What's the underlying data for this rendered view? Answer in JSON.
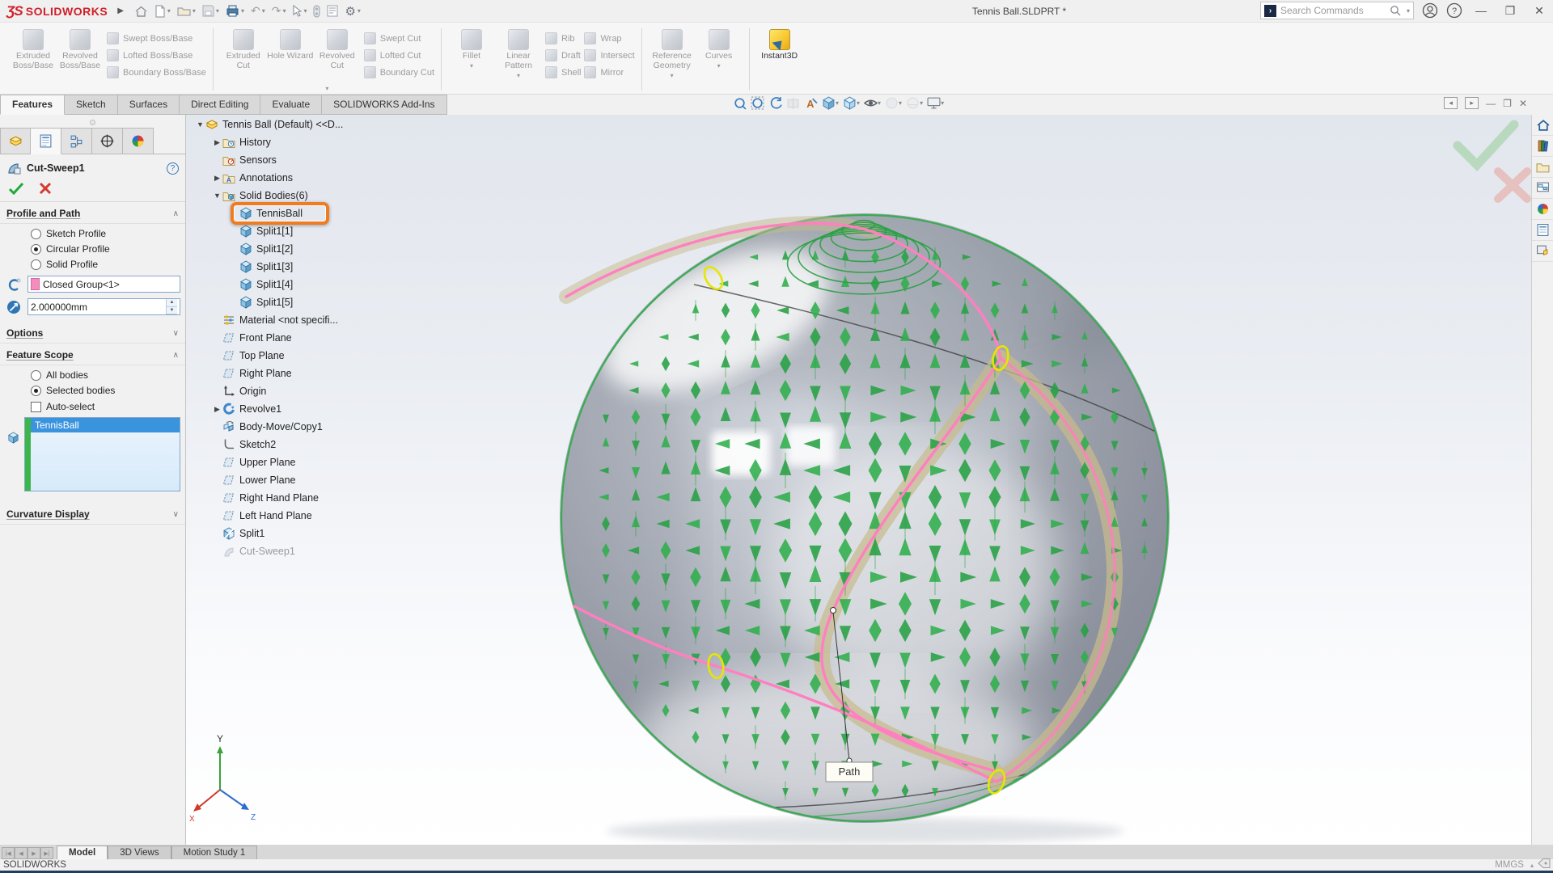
{
  "titlebar": {
    "logo_ds": "ƷS",
    "logo_text": "SOLIDWORKS",
    "doc_title": "Tennis Ball.SLDPRT *",
    "search_placeholder": "Search Commands"
  },
  "tabs": {
    "items": [
      "Features",
      "Sketch",
      "Surfaces",
      "Direct Editing",
      "Evaluate",
      "SOLIDWORKS Add-Ins"
    ],
    "active": "Features"
  },
  "ribbon": {
    "groups": [
      {
        "big": [
          "Extruded Boss/Base",
          "Revolved Boss/Base"
        ],
        "stack": [
          "Swept Boss/Base",
          "Lofted Boss/Base",
          "Boundary Boss/Base"
        ]
      },
      {
        "big": [
          "Extruded Cut",
          "Hole Wizard",
          "Revolved Cut"
        ],
        "stack": [
          "Swept Cut",
          "Lofted Cut",
          "Boundary Cut"
        ],
        "caret": true
      },
      {
        "big": [
          "Fillet",
          "Linear Pattern"
        ],
        "stack": [
          "Rib",
          "Draft",
          "Shell"
        ],
        "stack2": [
          "Wrap",
          "Intersect",
          "Mirror"
        ],
        "bigcarets": true
      },
      {
        "big": [
          "Reference Geometry",
          "Curves"
        ],
        "bigcarets": true
      },
      {
        "big": [
          "Instant3D"
        ],
        "enabled": true
      }
    ]
  },
  "property_manager": {
    "title": "Cut-Sweep1",
    "profile_and_path": {
      "header": "Profile and Path",
      "radios": [
        "Sketch Profile",
        "Circular Profile",
        "Solid Profile"
      ],
      "selected_radio": "Circular Profile",
      "path_value": "Closed Group<1>",
      "diameter_value": "2.000000mm"
    },
    "options_header": "Options",
    "feature_scope": {
      "header": "Feature Scope",
      "radios": [
        "All bodies",
        "Selected bodies"
      ],
      "selected_radio": "Selected bodies",
      "auto_select_label": "Auto-select",
      "auto_select_checked": false,
      "bodies": [
        "TennisBall"
      ]
    },
    "curvature_header": "Curvature Display"
  },
  "feature_tree": {
    "root": {
      "label": "Tennis Ball (Default) <<D...",
      "icon": "part",
      "arrow": "down",
      "level": 0
    },
    "items": [
      {
        "label": "History",
        "icon": "history",
        "arrow": "right",
        "level": 1
      },
      {
        "label": "Sensors",
        "icon": "sensors",
        "level": 1
      },
      {
        "label": "Annotations",
        "icon": "annotations",
        "arrow": "right",
        "level": 1
      },
      {
        "label": "Solid Bodies(6)",
        "icon": "bodies_folder",
        "arrow": "down",
        "level": 1
      },
      {
        "label": "TennisBall",
        "icon": "body",
        "level": 2,
        "highlight": true
      },
      {
        "label": "Split1[1]",
        "icon": "body",
        "level": 2
      },
      {
        "label": "Split1[2]",
        "icon": "body",
        "level": 2
      },
      {
        "label": "Split1[3]",
        "icon": "body",
        "level": 2
      },
      {
        "label": "Split1[4]",
        "icon": "body",
        "level": 2
      },
      {
        "label": "Split1[5]",
        "icon": "body",
        "level": 2
      },
      {
        "label": "Material <not specifi...",
        "icon": "material",
        "level": 1
      },
      {
        "label": "Front Plane",
        "icon": "plane",
        "level": 1
      },
      {
        "label": "Top Plane",
        "icon": "plane",
        "level": 1
      },
      {
        "label": "Right Plane",
        "icon": "plane",
        "level": 1
      },
      {
        "label": "Origin",
        "icon": "origin",
        "level": 1
      },
      {
        "label": "Revolve1",
        "icon": "revolve",
        "arrow": "right",
        "level": 1
      },
      {
        "label": "Body-Move/Copy1",
        "icon": "bodymove",
        "level": 1
      },
      {
        "label": "Sketch2",
        "icon": "sketch",
        "level": 1
      },
      {
        "label": "Upper Plane",
        "icon": "plane",
        "level": 1
      },
      {
        "label": "Lower Plane",
        "icon": "plane",
        "level": 1
      },
      {
        "label": "Right Hand Plane",
        "icon": "plane",
        "level": 1
      },
      {
        "label": "Left Hand Plane",
        "icon": "plane",
        "level": 1
      },
      {
        "label": "Split1",
        "icon": "split",
        "level": 1
      },
      {
        "label": "Cut-Sweep1",
        "icon": "cutsweep",
        "level": 1,
        "dimmed": true
      }
    ]
  },
  "viewport": {
    "path_callout": "Path",
    "triad": {
      "x": "X",
      "y": "Y",
      "z": "Z"
    }
  },
  "doc_tabs": {
    "items": [
      "Model",
      "3D Views",
      "Motion Study 1"
    ],
    "active": "Model"
  },
  "statusbar": {
    "app": "SOLIDWORKS",
    "units": "MMGS"
  },
  "colors": {
    "accent_orange": "#ee7c23",
    "selection_blue": "#3a93dd",
    "comb_green": "#27a143",
    "path_pink": "#ff7fc0",
    "seam_tan": "#c6ba8c",
    "highlight_yellow": "#e6e600",
    "statusbar_strip": "#1d3e63"
  }
}
